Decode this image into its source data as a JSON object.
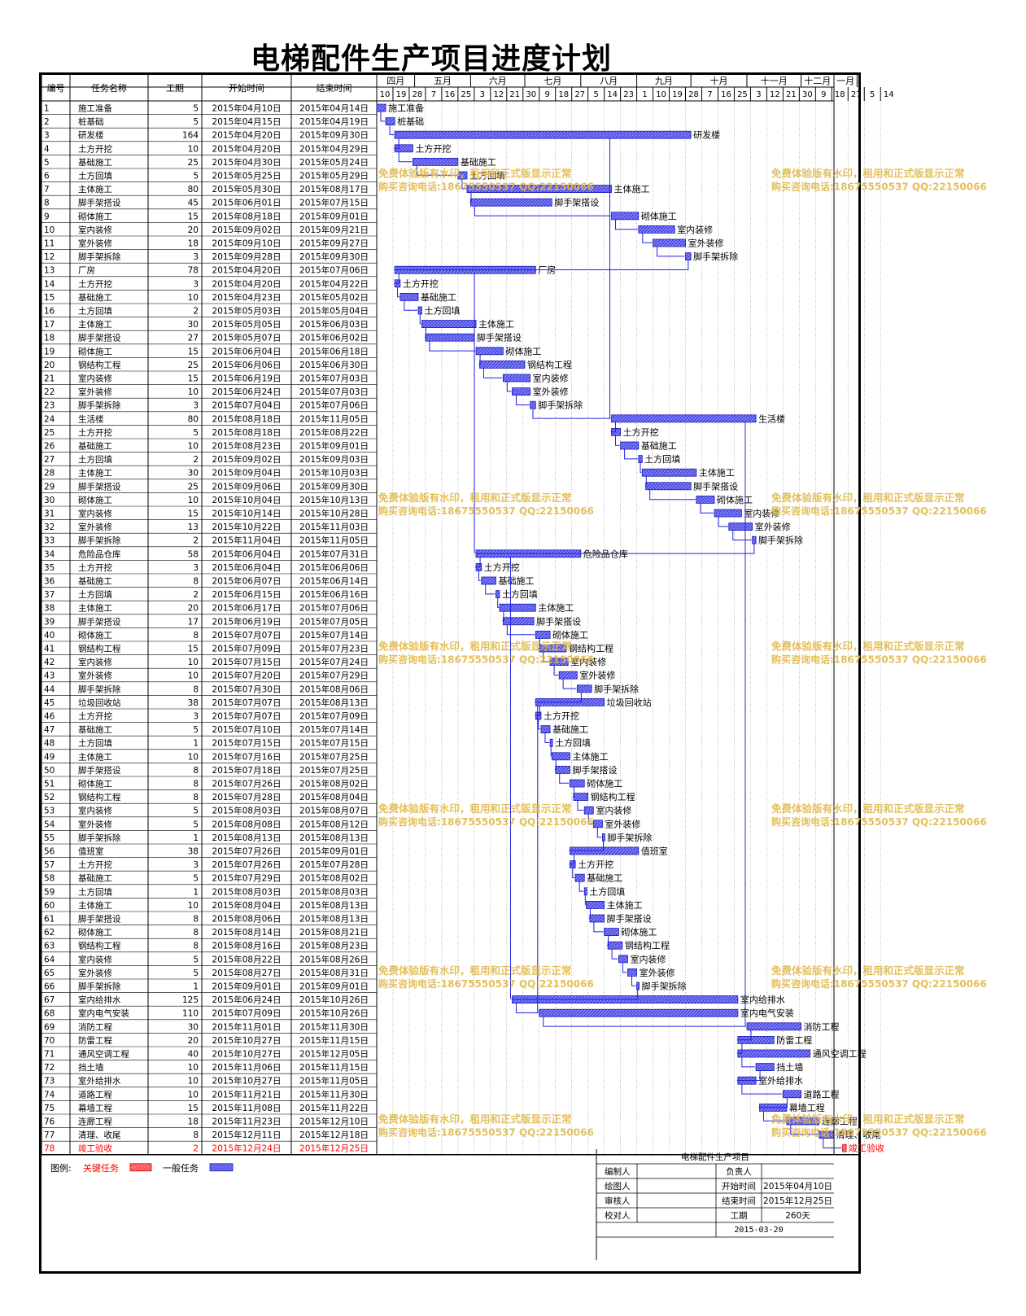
{
  "title": "电梯配件生产项目进度计划",
  "columns": {
    "no": "编号",
    "name": "任务名称",
    "days": "工期",
    "start": "开始时间",
    "end": "结束时间"
  },
  "colors": {
    "bar": "#4b4be6",
    "bar_border": "#1a1ab4",
    "critical": "#ff0000",
    "link": "#2020e0",
    "watermark": "#e0b84a"
  },
  "months": [
    "四月",
    "五月",
    "六月",
    "七月",
    "八月",
    "九月",
    "十月",
    "十一月",
    "十二月",
    "一月"
  ],
  "days": [
    "10",
    "19",
    "28",
    "7",
    "16",
    "25",
    "3",
    "12",
    "21",
    "30",
    "9",
    "18",
    "27",
    "5",
    "14",
    "23",
    "1",
    "10",
    "19",
    "28",
    "7",
    "16",
    "25",
    "3",
    "12",
    "21",
    "30",
    "9",
    "18",
    "27",
    "5",
    "14"
  ],
  "watermark": [
    "免费体验版有水印，租用和正式版显示正常",
    "购买咨询电话:18675550537 QQ:22150066"
  ],
  "legend": {
    "label": "图例:",
    "critical": "关键任务",
    "normal": "一般任务"
  },
  "info": {
    "project": "电梯配件生产项目",
    "compiler": "编制人",
    "owner": "负责人",
    "drawer": "绘图人",
    "start_label": "开始时间",
    "start": "2015年04月10日",
    "reviewer": "审核人",
    "end_label": "结束时间",
    "end": "2015年12月25日",
    "checker": "校对人",
    "duration_label": "工期",
    "duration": "260天",
    "date": "2015-03-20"
  },
  "chart_data": {
    "type": "gantt",
    "x_start": "2015-04-10",
    "tasks": [
      {
        "id": 1,
        "name": "施工准备",
        "days": 5,
        "start": "2015年04月10日",
        "end": "2015年04月14日",
        "s": 0
      },
      {
        "id": 2,
        "name": "桩基础",
        "days": 5,
        "start": "2015年04月15日",
        "end": "2015年04月19日",
        "s": 5
      },
      {
        "id": 3,
        "name": "研发楼",
        "days": 164,
        "start": "2015年04月20日",
        "end": "2015年09月30日",
        "s": 10
      },
      {
        "id": 4,
        "name": "土方开挖",
        "days": 10,
        "start": "2015年04月20日",
        "end": "2015年04月29日",
        "s": 10
      },
      {
        "id": 5,
        "name": "基础施工",
        "days": 25,
        "start": "2015年04月30日",
        "end": "2015年05月24日",
        "s": 20
      },
      {
        "id": 6,
        "name": "土方回填",
        "days": 5,
        "start": "2015年05月25日",
        "end": "2015年05月29日",
        "s": 45
      },
      {
        "id": 7,
        "name": "主体施工",
        "days": 80,
        "start": "2015年05月30日",
        "end": "2015年08月17日",
        "s": 50
      },
      {
        "id": 8,
        "name": "脚手架搭设",
        "days": 45,
        "start": "2015年06月01日",
        "end": "2015年07月15日",
        "s": 52
      },
      {
        "id": 9,
        "name": "砌体施工",
        "days": 15,
        "start": "2015年08月18日",
        "end": "2015年09月01日",
        "s": 130
      },
      {
        "id": 10,
        "name": "室内装修",
        "days": 20,
        "start": "2015年09月02日",
        "end": "2015年09月21日",
        "s": 145
      },
      {
        "id": 11,
        "name": "室外装修",
        "days": 18,
        "start": "2015年09月10日",
        "end": "2015年09月27日",
        "s": 153
      },
      {
        "id": 12,
        "name": "脚手架拆除",
        "days": 3,
        "start": "2015年09月28日",
        "end": "2015年09月30日",
        "s": 171
      },
      {
        "id": 13,
        "name": "厂房",
        "days": 78,
        "start": "2015年04月20日",
        "end": "2015年07月06日",
        "s": 10
      },
      {
        "id": 14,
        "name": "土方开挖",
        "days": 3,
        "start": "2015年04月20日",
        "end": "2015年04月22日",
        "s": 10
      },
      {
        "id": 15,
        "name": "基础施工",
        "days": 10,
        "start": "2015年04月23日",
        "end": "2015年05月02日",
        "s": 13
      },
      {
        "id": 16,
        "name": "土方回填",
        "days": 2,
        "start": "2015年05月03日",
        "end": "2015年05月04日",
        "s": 23
      },
      {
        "id": 17,
        "name": "主体施工",
        "days": 30,
        "start": "2015年05月05日",
        "end": "2015年06月03日",
        "s": 25
      },
      {
        "id": 18,
        "name": "脚手架搭设",
        "days": 27,
        "start": "2015年05月07日",
        "end": "2015年06月02日",
        "s": 27
      },
      {
        "id": 19,
        "name": "砌体施工",
        "days": 15,
        "start": "2015年06月04日",
        "end": "2015年06月18日",
        "s": 55
      },
      {
        "id": 20,
        "name": "钢结构工程",
        "days": 25,
        "start": "2015年06月06日",
        "end": "2015年06月30日",
        "s": 57
      },
      {
        "id": 21,
        "name": "室内装修",
        "days": 15,
        "start": "2015年06月19日",
        "end": "2015年07月03日",
        "s": 70
      },
      {
        "id": 22,
        "name": "室外装修",
        "days": 10,
        "start": "2015年06月24日",
        "end": "2015年07月03日",
        "s": 75
      },
      {
        "id": 23,
        "name": "脚手架拆除",
        "days": 3,
        "start": "2015年07月04日",
        "end": "2015年07月06日",
        "s": 85
      },
      {
        "id": 24,
        "name": "生活楼",
        "days": 80,
        "start": "2015年08月18日",
        "end": "2015年11月05日",
        "s": 130
      },
      {
        "id": 25,
        "name": "土方开挖",
        "days": 5,
        "start": "2015年08月18日",
        "end": "2015年08月22日",
        "s": 130
      },
      {
        "id": 26,
        "name": "基础施工",
        "days": 10,
        "start": "2015年08月23日",
        "end": "2015年09月01日",
        "s": 135
      },
      {
        "id": 27,
        "name": "土方回填",
        "days": 2,
        "start": "2015年09月02日",
        "end": "2015年09月03日",
        "s": 145
      },
      {
        "id": 28,
        "name": "主体施工",
        "days": 30,
        "start": "2015年09月04日",
        "end": "2015年10月03日",
        "s": 147
      },
      {
        "id": 29,
        "name": "脚手架搭设",
        "days": 25,
        "start": "2015年09月06日",
        "end": "2015年09月30日",
        "s": 149
      },
      {
        "id": 30,
        "name": "砌体施工",
        "days": 10,
        "start": "2015年10月04日",
        "end": "2015年10月13日",
        "s": 177
      },
      {
        "id": 31,
        "name": "室内装修",
        "days": 15,
        "start": "2015年10月14日",
        "end": "2015年10月28日",
        "s": 187
      },
      {
        "id": 32,
        "name": "室外装修",
        "days": 13,
        "start": "2015年10月22日",
        "end": "2015年11月03日",
        "s": 195
      },
      {
        "id": 33,
        "name": "脚手架拆除",
        "days": 2,
        "start": "2015年11月04日",
        "end": "2015年11月05日",
        "s": 208
      },
      {
        "id": 34,
        "name": "危险品仓库",
        "days": 58,
        "start": "2015年06月04日",
        "end": "2015年07月31日",
        "s": 55
      },
      {
        "id": 35,
        "name": "土方开挖",
        "days": 3,
        "start": "2015年06月04日",
        "end": "2015年06月06日",
        "s": 55
      },
      {
        "id": 36,
        "name": "基础施工",
        "days": 8,
        "start": "2015年06月07日",
        "end": "2015年06月14日",
        "s": 58
      },
      {
        "id": 37,
        "name": "土方回填",
        "days": 2,
        "start": "2015年06月15日",
        "end": "2015年06月16日",
        "s": 66
      },
      {
        "id": 38,
        "name": "主体施工",
        "days": 20,
        "start": "2015年06月17日",
        "end": "2015年07月06日",
        "s": 68
      },
      {
        "id": 39,
        "name": "脚手架搭设",
        "days": 17,
        "start": "2015年06月19日",
        "end": "2015年07月05日",
        "s": 70
      },
      {
        "id": 40,
        "name": "砌体施工",
        "days": 8,
        "start": "2015年07月07日",
        "end": "2015年07月14日",
        "s": 88
      },
      {
        "id": 41,
        "name": "钢结构工程",
        "days": 15,
        "start": "2015年07月09日",
        "end": "2015年07月23日",
        "s": 90
      },
      {
        "id": 42,
        "name": "室内装修",
        "days": 10,
        "start": "2015年07月15日",
        "end": "2015年07月24日",
        "s": 96
      },
      {
        "id": 43,
        "name": "室外装修",
        "days": 10,
        "start": "2015年07月20日",
        "end": "2015年07月29日",
        "s": 101
      },
      {
        "id": 44,
        "name": "脚手架拆除",
        "days": 8,
        "start": "2015年07月30日",
        "end": "2015年08月06日",
        "s": 111
      },
      {
        "id": 45,
        "name": "垃圾回收站",
        "days": 38,
        "start": "2015年07月07日",
        "end": "2015年08月13日",
        "s": 88
      },
      {
        "id": 46,
        "name": "土方开挖",
        "days": 3,
        "start": "2015年07月07日",
        "end": "2015年07月09日",
        "s": 88
      },
      {
        "id": 47,
        "name": "基础施工",
        "days": 5,
        "start": "2015年07月10日",
        "end": "2015年07月14日",
        "s": 91
      },
      {
        "id": 48,
        "name": "土方回填",
        "days": 1,
        "start": "2015年07月15日",
        "end": "2015年07月15日",
        "s": 96
      },
      {
        "id": 49,
        "name": "主体施工",
        "days": 10,
        "start": "2015年07月16日",
        "end": "2015年07月25日",
        "s": 97
      },
      {
        "id": 50,
        "name": "脚手架搭设",
        "days": 8,
        "start": "2015年07月18日",
        "end": "2015年07月25日",
        "s": 99
      },
      {
        "id": 51,
        "name": "砌体施工",
        "days": 8,
        "start": "2015年07月26日",
        "end": "2015年08月02日",
        "s": 107
      },
      {
        "id": 52,
        "name": "钢结构工程",
        "days": 8,
        "start": "2015年07月28日",
        "end": "2015年08月04日",
        "s": 109
      },
      {
        "id": 53,
        "name": "室内装修",
        "days": 5,
        "start": "2015年08月03日",
        "end": "2015年08月07日",
        "s": 115
      },
      {
        "id": 54,
        "name": "室外装修",
        "days": 5,
        "start": "2015年08月08日",
        "end": "2015年08月12日",
        "s": 120
      },
      {
        "id": 55,
        "name": "脚手架拆除",
        "days": 1,
        "start": "2015年08月13日",
        "end": "2015年08月13日",
        "s": 125
      },
      {
        "id": 56,
        "name": "值班室",
        "days": 38,
        "start": "2015年07月26日",
        "end": "2015年09月01日",
        "s": 107
      },
      {
        "id": 57,
        "name": "土方开挖",
        "days": 3,
        "start": "2015年07月26日",
        "end": "2015年07月28日",
        "s": 107
      },
      {
        "id": 58,
        "name": "基础施工",
        "days": 5,
        "start": "2015年07月29日",
        "end": "2015年08月02日",
        "s": 110
      },
      {
        "id": 59,
        "name": "土方回填",
        "days": 1,
        "start": "2015年08月03日",
        "end": "2015年08月03日",
        "s": 115
      },
      {
        "id": 60,
        "name": "主体施工",
        "days": 10,
        "start": "2015年08月04日",
        "end": "2015年08月13日",
        "s": 116
      },
      {
        "id": 61,
        "name": "脚手架搭设",
        "days": 8,
        "start": "2015年08月06日",
        "end": "2015年08月13日",
        "s": 118
      },
      {
        "id": 62,
        "name": "砌体施工",
        "days": 8,
        "start": "2015年08月14日",
        "end": "2015年08月21日",
        "s": 126
      },
      {
        "id": 63,
        "name": "钢结构工程",
        "days": 8,
        "start": "2015年08月16日",
        "end": "2015年08月23日",
        "s": 128
      },
      {
        "id": 64,
        "name": "室内装修",
        "days": 5,
        "start": "2015年08月22日",
        "end": "2015年08月26日",
        "s": 134
      },
      {
        "id": 65,
        "name": "室外装修",
        "days": 5,
        "start": "2015年08月27日",
        "end": "2015年08月31日",
        "s": 139
      },
      {
        "id": 66,
        "name": "脚手架拆除",
        "days": 1,
        "start": "2015年09月01日",
        "end": "2015年09月01日",
        "s": 144
      },
      {
        "id": 67,
        "name": "室内给排水",
        "days": 125,
        "start": "2015年06月24日",
        "end": "2015年10月26日",
        "s": 75
      },
      {
        "id": 68,
        "name": "室内电气安装",
        "days": 110,
        "start": "2015年07月09日",
        "end": "2015年10月26日",
        "s": 90
      },
      {
        "id": 69,
        "name": "消防工程",
        "days": 30,
        "start": "2015年11月01日",
        "end": "2015年11月30日",
        "s": 205
      },
      {
        "id": 70,
        "name": "防雷工程",
        "days": 20,
        "start": "2015年10月27日",
        "end": "2015年11月15日",
        "s": 200
      },
      {
        "id": 71,
        "name": "通风空调工程",
        "days": 40,
        "start": "2015年10月27日",
        "end": "2015年12月05日",
        "s": 200
      },
      {
        "id": 72,
        "name": "挡土墙",
        "days": 10,
        "start": "2015年11月06日",
        "end": "2015年11月15日",
        "s": 210
      },
      {
        "id": 73,
        "name": "室外给排水",
        "days": 10,
        "start": "2015年10月27日",
        "end": "2015年11月05日",
        "s": 200
      },
      {
        "id": 74,
        "name": "道路工程",
        "days": 10,
        "start": "2015年11月21日",
        "end": "2015年11月30日",
        "s": 225
      },
      {
        "id": 75,
        "name": "幕墙工程",
        "days": 15,
        "start": "2015年11月08日",
        "end": "2015年11月22日",
        "s": 212
      },
      {
        "id": 76,
        "name": "连廊工程",
        "days": 18,
        "start": "2015年11月23日",
        "end": "2015年12月10日",
        "s": 227
      },
      {
        "id": 77,
        "name": "清理、收尾",
        "days": 8,
        "start": "2015年12月11日",
        "end": "2015年12月18日",
        "s": 245
      },
      {
        "id": 78,
        "name": "竣工验收",
        "days": 2,
        "start": "2015年12月24日",
        "end": "2015年12月25日",
        "s": 258,
        "critical": true
      }
    ]
  }
}
